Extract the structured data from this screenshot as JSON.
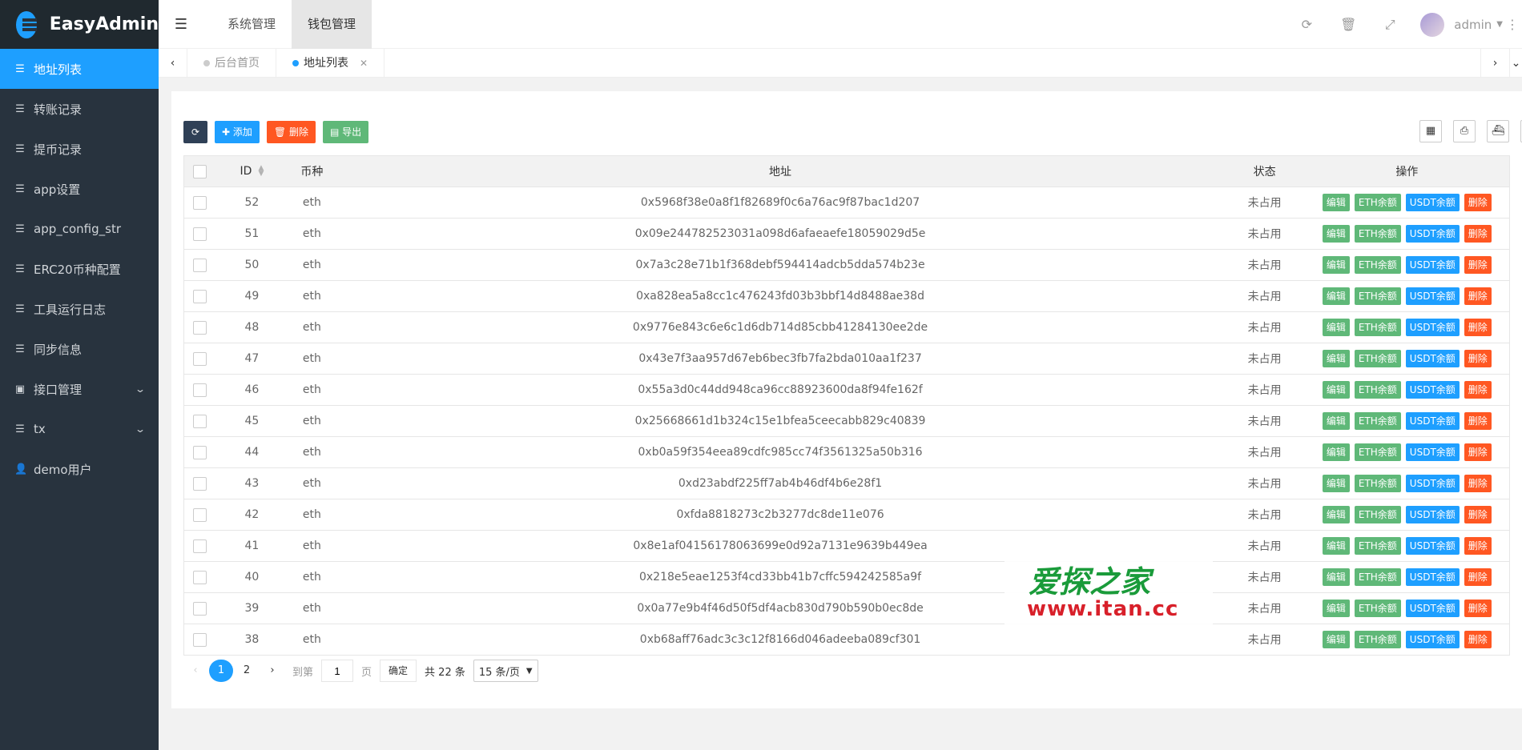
{
  "app": {
    "name": "EasyAdmin"
  },
  "sidebar": {
    "items": [
      {
        "label": "地址列表",
        "icon": "list-icon",
        "active": true
      },
      {
        "label": "转账记录",
        "icon": "list-icon"
      },
      {
        "label": "提币记录",
        "icon": "list-icon"
      },
      {
        "label": "app设置",
        "icon": "list-icon"
      },
      {
        "label": "app_config_str",
        "icon": "list-icon"
      },
      {
        "label": "ERC20币种配置",
        "icon": "list-icon"
      },
      {
        "label": "工具运行日志",
        "icon": "list-icon"
      },
      {
        "label": "同步信息",
        "icon": "list-icon"
      },
      {
        "label": "接口管理",
        "icon": "contact-icon",
        "expandable": true
      },
      {
        "label": "tx",
        "icon": "list-icon",
        "expandable": true
      },
      {
        "label": "demo用户",
        "icon": "user-icon"
      }
    ]
  },
  "header": {
    "nav": [
      "系统管理",
      "钱包管理"
    ],
    "active_nav": "钱包管理",
    "user": "admin"
  },
  "tabs": {
    "items": [
      {
        "label": "后台首页",
        "active": false
      },
      {
        "label": "地址列表",
        "active": true
      }
    ]
  },
  "toolbar": {
    "refresh": "",
    "add": "添加",
    "delete": "删除",
    "export": "导出"
  },
  "table": {
    "columns": [
      "ID",
      "币种",
      "地址",
      "状态",
      "操作"
    ],
    "actions": [
      "编辑",
      "ETH余额",
      "USDT余额",
      "删除"
    ],
    "rows": [
      {
        "id": "52",
        "coin": "eth",
        "address": "0x5968f38e0a8f1f82689f0c6a76ac9f87bac1d207",
        "status": "未占用"
      },
      {
        "id": "51",
        "coin": "eth",
        "address": "0x09e24478252303 1a098d6afaeaefe18059029d5e",
        "status": "未占用"
      },
      {
        "id": "50",
        "coin": "eth",
        "address": "0x7a3c28e71b1f368debf594414adcb5dda574b23e",
        "status": "未占用"
      },
      {
        "id": "49",
        "coin": "eth",
        "address": "0xa828ea5a8cc1c476243fd03b3bbf14d8488ae38d",
        "status": "未占用"
      },
      {
        "id": "48",
        "coin": "eth",
        "address": "0x9776e843c6e6c1d6db714d85cbb41284130ee2de",
        "status": "未占用"
      },
      {
        "id": "47",
        "coin": "eth",
        "address": "0x43e7f3aa957d67eb6bec3fb7fa2bda010aa1f237",
        "status": "未占用"
      },
      {
        "id": "46",
        "coin": "eth",
        "address": "0x55a3d0c44dd948ca96cc88923600da8f94fe162f",
        "status": "未占用"
      },
      {
        "id": "45",
        "coin": "eth",
        "address": "0x25668661d1b324c15e1bfea5ceecabb829c40839",
        "status": "未占用"
      },
      {
        "id": "44",
        "coin": "eth",
        "address": "0xb0a59f354eea89cdfc985cc74f3561325a50b316",
        "status": "未占用"
      },
      {
        "id": "43",
        "coin": "eth",
        "address": "0xd23abdf225ff7ab4b46df4b6e28f1",
        "status": "未占用"
      },
      {
        "id": "42",
        "coin": "eth",
        "address": "0xfda8818273c2b3277dc8de11e076",
        "status": "未占用"
      },
      {
        "id": "41",
        "coin": "eth",
        "address": "0x8e1af04156178063699e0d92a7131e9639b449ea",
        "status": "未占用"
      },
      {
        "id": "40",
        "coin": "eth",
        "address": "0x218e5eae1253f4cd33bb41b7cffc594242585a9f",
        "status": "未占用"
      },
      {
        "id": "39",
        "coin": "eth",
        "address": "0x0a77e9b4f46d50f5df4acb830d790b590b0ec8de",
        "status": "未占用"
      },
      {
        "id": "38",
        "coin": "eth",
        "address": "0xb68aff76adc3c3c12f8166d046adeeba089cf301",
        "status": "未占用"
      }
    ]
  },
  "pager": {
    "pages": [
      "1",
      "2"
    ],
    "current": "1",
    "goto_label": "到第",
    "page_value": "1",
    "page_suffix": "页",
    "confirm": "确定",
    "total": "共 22 条",
    "page_size": "15 条/页"
  },
  "watermark": {
    "cn": "爱探之家",
    "url": "www.itan.cc"
  },
  "colors": {
    "sidebar": "#28333e",
    "accent": "#1e9fff",
    "green": "#5fb878",
    "red": "#ff5722"
  }
}
